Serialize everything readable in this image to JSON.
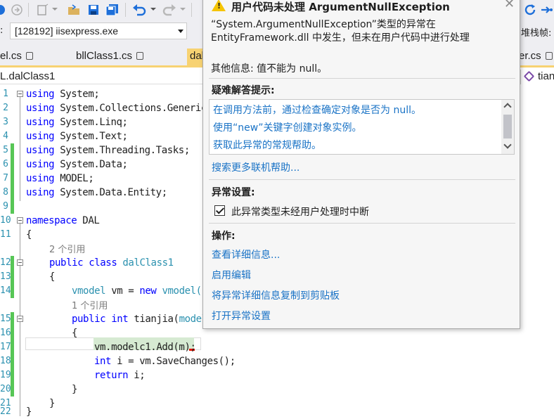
{
  "process": {
    "value": "[128192] iisexpress.exe",
    "stack_label": "堆栈帧:"
  },
  "tabs": [
    {
      "label": "el.cs"
    },
    {
      "label": "bllClass1.cs"
    },
    {
      "label": "dal"
    },
    {
      "label": "er.cs"
    }
  ],
  "nav": {
    "left": "L.dalClass1",
    "right": "tian"
  },
  "code": {
    "lines": [
      {
        "n": "1",
        "t": "System;"
      },
      {
        "n": "2",
        "t": "System.Collections.Generic"
      },
      {
        "n": "3",
        "t": "System.Linq;"
      },
      {
        "n": "4",
        "t": "System.Text;"
      },
      {
        "n": "5",
        "t": "System.Threading.Tasks;"
      },
      {
        "n": "6",
        "t": "System.Data;"
      },
      {
        "n": "7",
        "t": "MODEL;"
      },
      {
        "n": "8",
        "t": "System.Data.Entity;"
      },
      {
        "n": "9",
        "t": ""
      },
      {
        "n": "10",
        "t": "DAL"
      },
      {
        "n": "11",
        "t": "{"
      },
      {
        "n": "12",
        "t": "dalClass1"
      },
      {
        "n": "13",
        "t": "{"
      },
      {
        "n": "14",
        "t": "vm = "
      },
      {
        "n": "15",
        "t": "tianjia("
      },
      {
        "n": "16",
        "t": "{"
      },
      {
        "n": "17",
        "t": "vm.modelc1.Add(m);"
      },
      {
        "n": "18",
        "t": "i = vm.SaveChanges();"
      },
      {
        "n": "19",
        "t": "i;"
      },
      {
        "n": "20",
        "t": "}"
      },
      {
        "n": "21",
        "t": "}"
      },
      {
        "n": "22",
        "t": "}"
      }
    ],
    "kw_using": "using",
    "kw_namespace": "namespace",
    "kw_public": "public",
    "kw_class": "class",
    "kw_new": "new",
    "kw_int": "int",
    "kw_return": "return",
    "ty_vmodel": "vmodel",
    "ty_vmodel_call": "vmodel()",
    "ty_model_param": "model",
    "ref_2": "2 个引用",
    "ref_1": "1 个引用"
  },
  "popup": {
    "title": "用户代码未处理 ArgumentNullException",
    "message": "“System.ArgumentNullException”类型的异常在 EntityFramework.dll 中发生，但未在用户代码中进行处理",
    "additional": "其他信息: 值不能为 null。",
    "tips_header": "疑难解答提示:",
    "tips": [
      "在调用方法前，通过检查确定对象是否为 null。",
      "使用“new”关键字创建对象实例。",
      "获取此异常的常规帮助。"
    ],
    "search_link": "搜索更多联机帮助...",
    "settings_header": "异常设置:",
    "checkbox_label": "此异常类型未经用户处理时中断",
    "checkbox_checked": true,
    "actions_header": "操作:",
    "actions": [
      "查看详细信息...",
      "启用编辑",
      "将异常详细信息复制到剪贴板",
      "打开异常设置"
    ]
  },
  "colors": {
    "keyword": "#0000ff",
    "type": "#2b91af",
    "link": "#1a73c6",
    "change_bar": "#57c656",
    "active_tab": "#f7d272"
  }
}
